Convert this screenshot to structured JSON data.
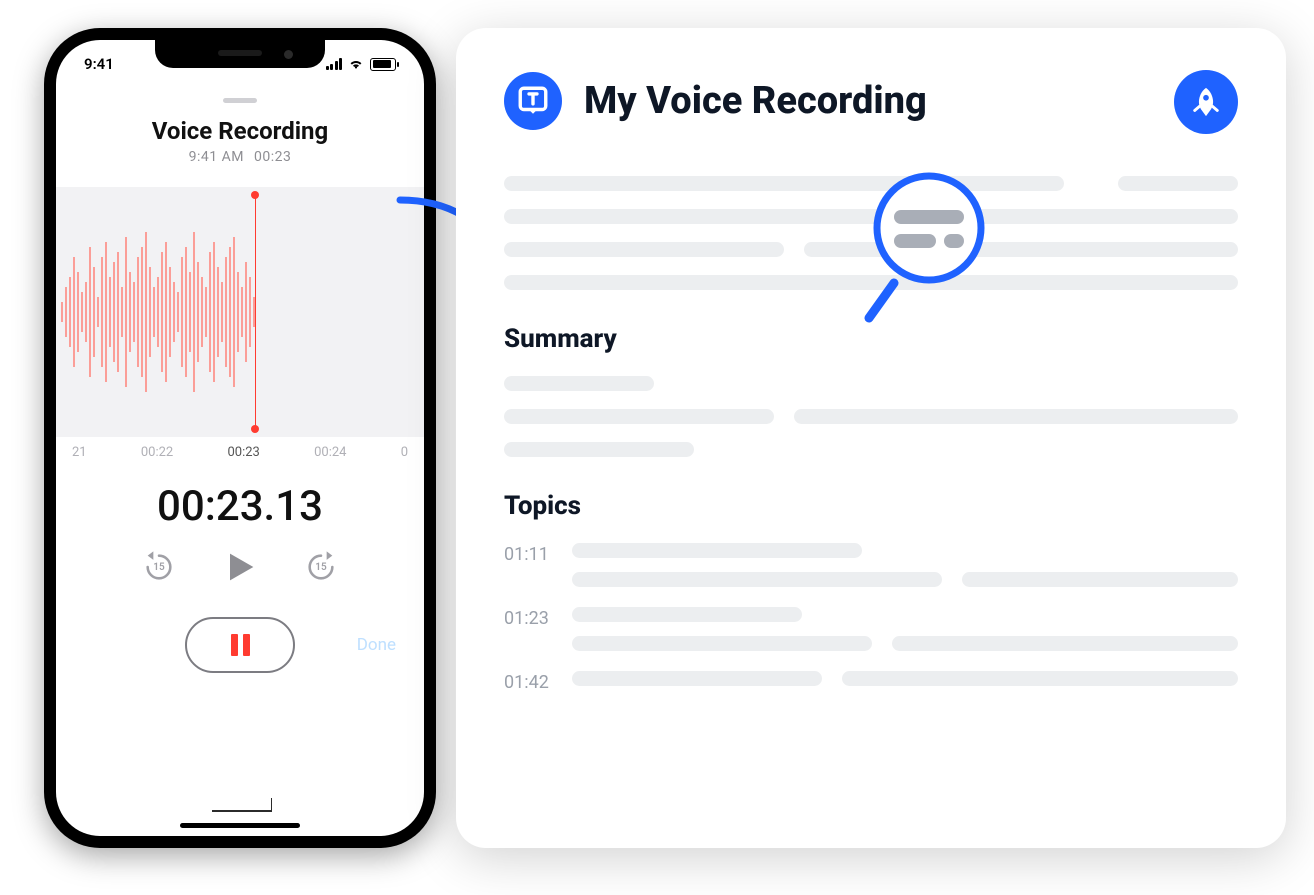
{
  "phone": {
    "statusTime": "9:41",
    "title": "Voice Recording",
    "subTime": "9:41 AM",
    "subDuration": "00:23",
    "ruler": [
      "21",
      "00:22",
      "00:23",
      "00:24",
      "0"
    ],
    "bigTimer": "00:23.13",
    "skipSeconds": "15",
    "doneLabel": "Done"
  },
  "card": {
    "title": "My Voice Recording",
    "summaryHeading": "Summary",
    "topicsHeading": "Topics",
    "topics": [
      {
        "time": "01:11"
      },
      {
        "time": "01:23"
      },
      {
        "time": "01:42"
      }
    ]
  },
  "colors": {
    "accent": "#1f62ff",
    "recordRed": "#ff3b30"
  }
}
